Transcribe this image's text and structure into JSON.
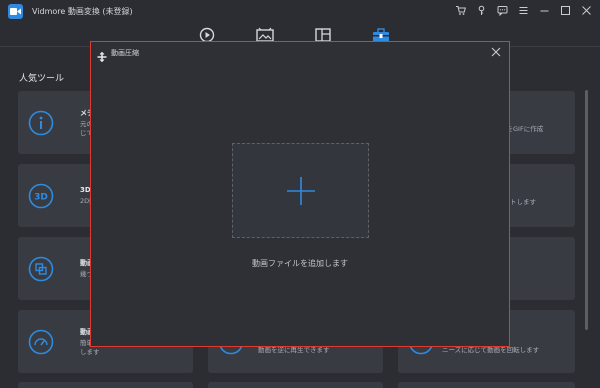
{
  "app": {
    "title": "Vidmore 動画変換 (未登録)"
  },
  "colors": {
    "accent": "#2f8be0",
    "modal_border": "#e0392e",
    "background": "#2b2d33",
    "card": "#383b42"
  },
  "window_controls": [
    "cart-icon",
    "key-icon",
    "chat-icon",
    "menu-icon",
    "minimize-icon",
    "maximize-icon",
    "close-icon"
  ],
  "topnav": {
    "items": [
      "converter-icon",
      "mv-icon",
      "collage-icon",
      "toolbox-icon"
    ],
    "active": "toolbox-icon"
  },
  "section": {
    "title": "人気ツール"
  },
  "cards": [
    {
      "title": "メディアメ",
      "desc1": "元のファイ",
      "desc2": "じて変更し",
      "icon": "info-icon"
    },
    {
      "title": "3D 作成",
      "desc1": "2D動画を",
      "desc2": "",
      "icon": "3d-icon"
    },
    {
      "title": "動画結合",
      "desc1": "幾つかの",
      "desc2": "",
      "icon": "merge-icon"
    },
    {
      "title": "動画スピー",
      "desc1": "簡単に動",
      "desc2": "します",
      "icon": "speed-icon"
    },
    {
      "title": "",
      "desc1": "ルをGIFに作成",
      "desc2": "",
      "icon": ""
    },
    {
      "title": "",
      "desc1": "トします",
      "desc2": "",
      "icon": ""
    },
    {
      "title": "",
      "desc1": "動画を逆に再生できます",
      "desc2": "",
      "icon": ""
    },
    {
      "title": "",
      "desc1": "ニーズに応じて動画を回転します",
      "desc2": "",
      "icon": ""
    }
  ],
  "modal": {
    "title": "動画圧縮",
    "drop_label": "動画ファイルを追加します"
  }
}
